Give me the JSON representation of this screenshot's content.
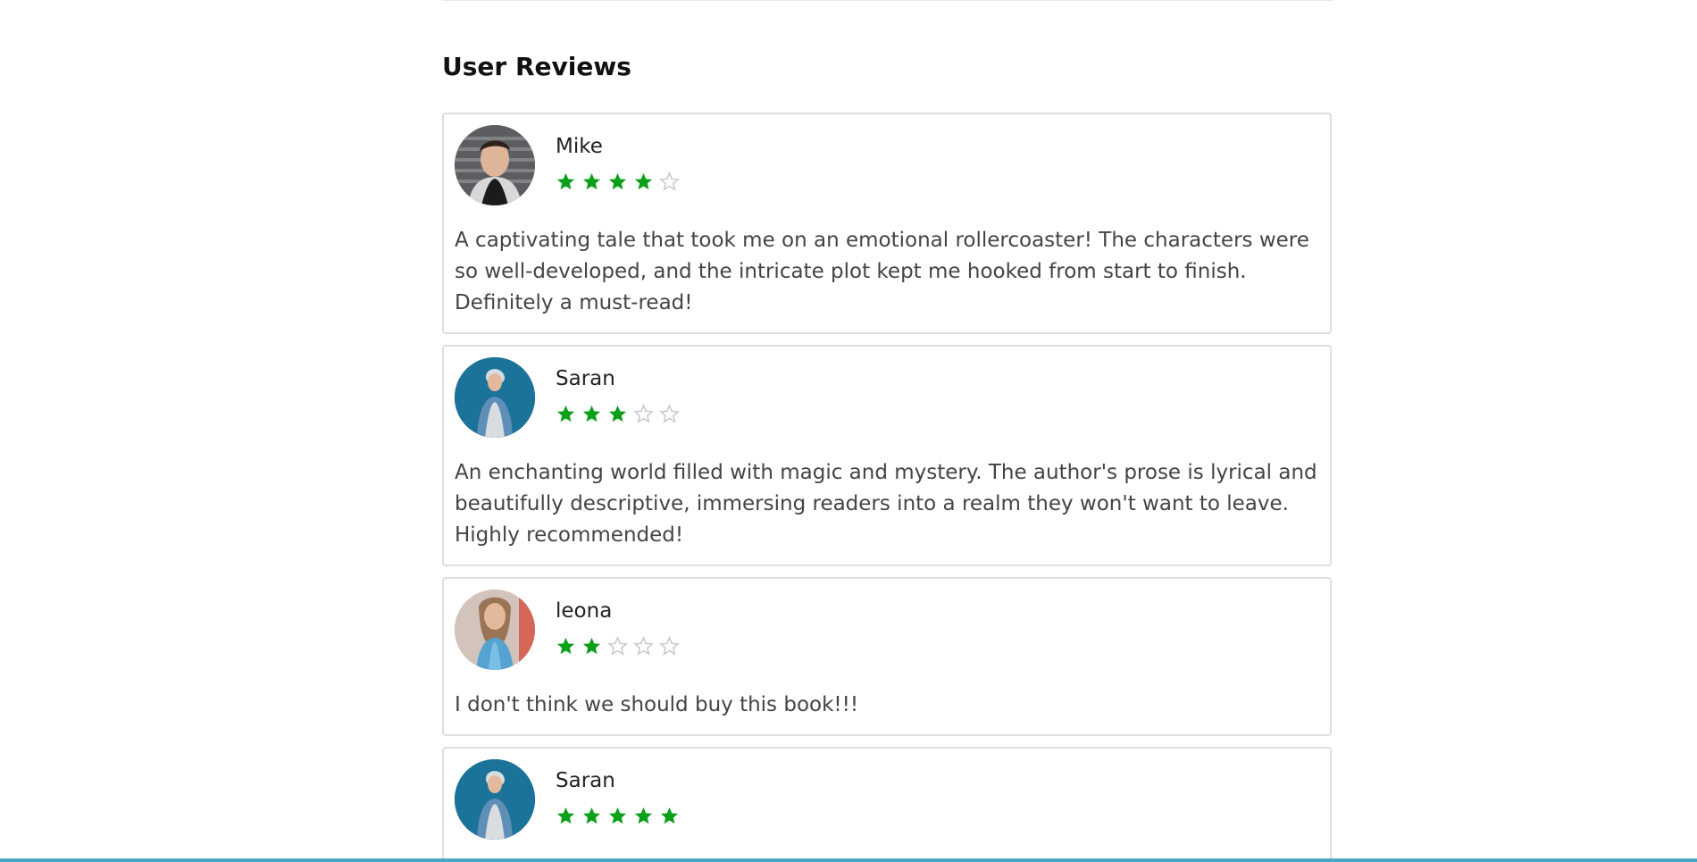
{
  "section": {
    "title": "User Reviews"
  },
  "colors": {
    "star_filled": "#0c9f1a",
    "star_empty": "#c9c9c9"
  },
  "reviews": [
    {
      "name": "Mike",
      "rating": 4,
      "max_rating": 5,
      "text": "A captivating tale that took me on an emotional rollercoaster! The characters were so well-developed, and the intricate plot kept me hooked from start to finish. Definitely a must-read!",
      "avatar": "avatar-mike"
    },
    {
      "name": "Saran",
      "rating": 3,
      "max_rating": 5,
      "text": "An enchanting world filled with magic and mystery. The author's prose is lyrical and beautifully descriptive, immersing readers into a realm they won't want to leave. Highly recommended!",
      "avatar": "avatar-saran"
    },
    {
      "name": "leona",
      "rating": 2,
      "max_rating": 5,
      "text": "I don't think we should buy this book!!!",
      "avatar": "avatar-leona"
    },
    {
      "name": "Saran",
      "rating": 5,
      "max_rating": 5,
      "text": "",
      "avatar": "avatar-saran"
    }
  ]
}
